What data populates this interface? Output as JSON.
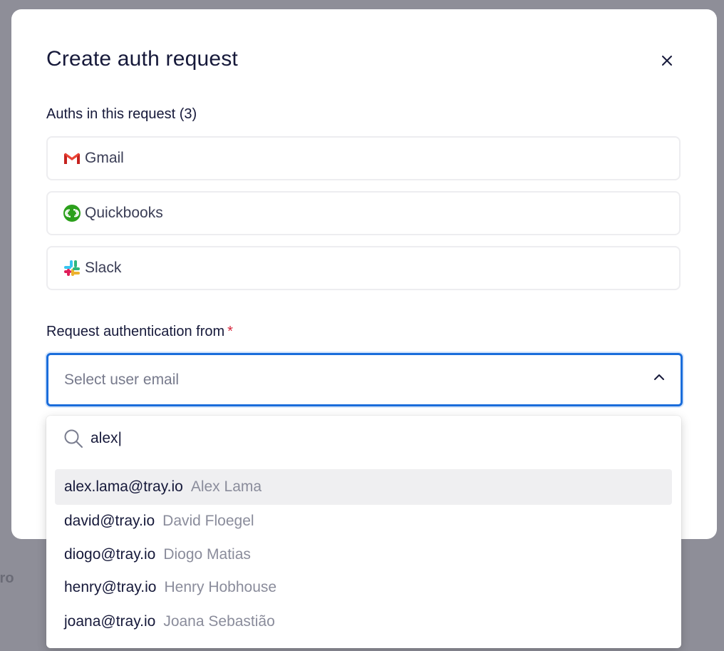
{
  "modal": {
    "title": "Create auth request",
    "auths_label": "Auths in this request (3)",
    "auths": [
      {
        "label": "Gmail",
        "icon": "gmail-icon"
      },
      {
        "label": "Quickbooks",
        "icon": "quickbooks-icon"
      },
      {
        "label": "Slack",
        "icon": "slack-icon"
      }
    ],
    "request_label": "Request authentication from",
    "required_mark": "*",
    "select": {
      "placeholder": "Select user email",
      "icon": "chevron-up-icon"
    }
  },
  "dropdown": {
    "search_value": "alex|",
    "search_icon": "search-icon",
    "options": [
      {
        "email": "alex.lama@tray.io",
        "name": "Alex Lama",
        "highlighted": true
      },
      {
        "email": "david@tray.io",
        "name": "David Floegel"
      },
      {
        "email": "diogo@tray.io",
        "name": "Diogo Matias"
      },
      {
        "email": "henry@tray.io",
        "name": "Henry Hobhouse"
      },
      {
        "email": "joana@tray.io",
        "name": "Joana Sebastião"
      }
    ]
  },
  "colors": {
    "accent": "#1a6ddb",
    "required": "#d6263c",
    "overlay": "#8e8e98",
    "highlight_row": "#efeff1"
  }
}
